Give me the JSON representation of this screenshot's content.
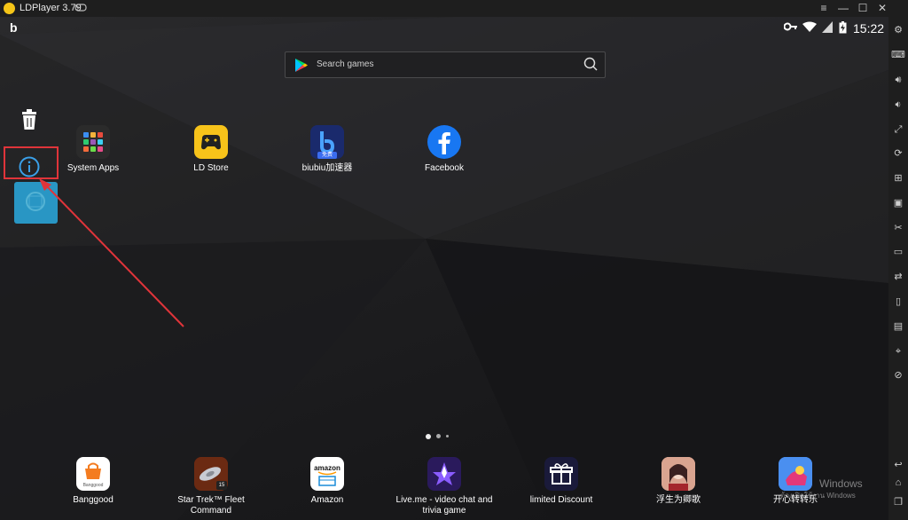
{
  "window": {
    "title": "LDPlayer 3.79"
  },
  "status": {
    "time": "15:22"
  },
  "search": {
    "placeholder": "Search games"
  },
  "desktop_apps": [
    {
      "label": "System Apps"
    },
    {
      "label": "LD Store"
    },
    {
      "label": "biubiu加速器",
      "badge": "免费"
    },
    {
      "label": "Facebook"
    }
  ],
  "dock_apps": [
    {
      "label": "Banggood",
      "icon_text": "Banggood"
    },
    {
      "label": "Star Trek™ Fleet Command",
      "badge": "15"
    },
    {
      "label": "Amazon",
      "icon_text": "amazon"
    },
    {
      "label": "Live.me - video chat and trivia game"
    },
    {
      "label": "limited Discount"
    },
    {
      "label": "浮生为卿歌"
    },
    {
      "label": "开心转转乐"
    }
  ],
  "watermark": {
    "line1": "Windows",
    "line2": "ต้องเปิดใช้งาน Windows"
  },
  "colors": {
    "highlight_box": "#e0343a",
    "arrow": "#e0343a",
    "info": "#3aa0e8"
  }
}
